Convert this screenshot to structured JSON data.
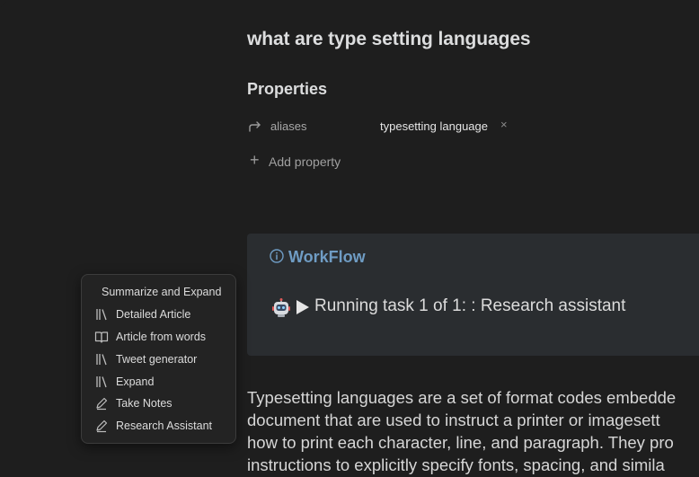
{
  "note": {
    "title": "what are type setting languages"
  },
  "properties": {
    "heading": "Properties",
    "items": [
      {
        "key": "aliases",
        "value": "typesetting language",
        "remove": "×",
        "icon": "arrow-turn-icon"
      }
    ],
    "add_label": "Add property",
    "add_icon": "+"
  },
  "callout": {
    "title": "WorkFlow",
    "icon": "info-circle-icon",
    "task_text": "Running task 1 of 1: : Research assistant",
    "task_icons": [
      "robot-icon",
      "play-icon"
    ],
    "title_color": "#6f9cc4",
    "background": "#2a2d30"
  },
  "body": {
    "lines": [
      "Typesetting languages are a set of format codes embedde",
      "document that are used to instruct a printer or imagesett",
      "how to print each character, line, and paragraph. They pro",
      "instructions to explicitly specify fonts, spacing, and simila"
    ]
  },
  "menu": {
    "header": "Summarize and Expand",
    "items": [
      {
        "label": "Detailed Article",
        "icon": "library-icon"
      },
      {
        "label": "Article from words",
        "icon": "book-open-icon"
      },
      {
        "label": "Tweet generator",
        "icon": "library-icon"
      },
      {
        "label": "Expand",
        "icon": "library-icon"
      },
      {
        "label": "Take Notes",
        "icon": "pencil-icon"
      },
      {
        "label": "Research Assistant",
        "icon": "pencil-icon"
      }
    ]
  }
}
